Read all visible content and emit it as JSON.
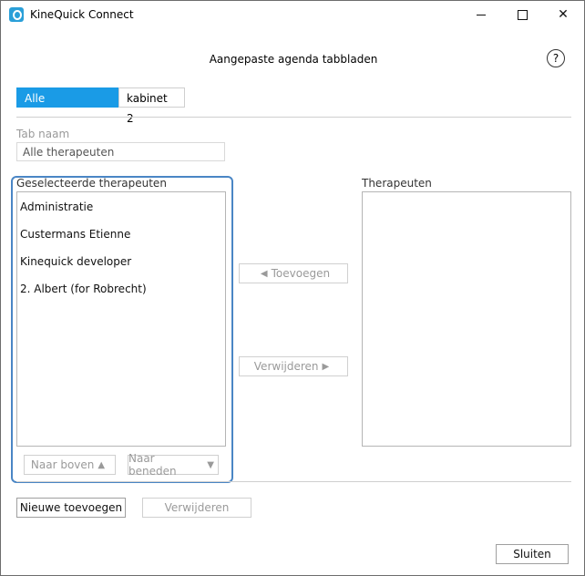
{
  "window": {
    "title": "KineQuick Connect",
    "controls": {
      "minimize": "—",
      "maximize": "☐",
      "close": "✕"
    }
  },
  "header": {
    "title": "Aangepaste agenda tabbladen",
    "help_label": "?"
  },
  "tabs": [
    {
      "label": "Alle therapeuten",
      "active": true
    },
    {
      "label": "kabinet 2",
      "active": false
    }
  ],
  "tab_name": {
    "label": "Tab naam",
    "value": "Alle therapeuten"
  },
  "selected": {
    "label": "Geselecteerde therapeuten",
    "items": [
      "Administratie",
      "Custermans Etienne",
      "Kinequick developer",
      "2. Albert (for Robrecht)"
    ]
  },
  "therapists": {
    "label": "Therapeuten",
    "items": []
  },
  "actions": {
    "add": {
      "label": "Toevoegen",
      "arrow": "◀"
    },
    "remove": {
      "label": "Verwijderen",
      "arrow": "▶"
    },
    "move_up": {
      "label": "Naar boven",
      "arrow": "▲"
    },
    "move_down": {
      "label": "Naar beneden",
      "arrow": "▼"
    }
  },
  "footer": {
    "new": "Nieuwe toevoegen",
    "delete": "Verwijderen",
    "close": "Sluiten"
  },
  "colors": {
    "accent": "#1a9be6",
    "highlight_border": "#4a86c5"
  }
}
